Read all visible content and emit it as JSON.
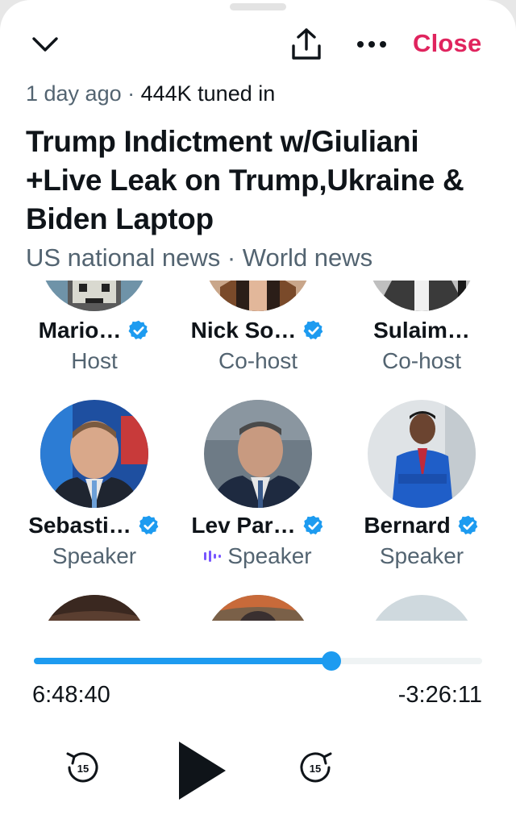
{
  "header": {
    "close_label": "Close",
    "collapse_icon": "chevron-down-icon",
    "share_icon": "share-icon",
    "more_icon": "more-icon"
  },
  "space": {
    "started": "1 day ago",
    "separator": " · ",
    "listeners": "444K tuned in",
    "title": "Trump Indictment w/Giuliani +Live Leak on Trump,Ukraine & Biden Laptop",
    "topics": "US national news · World news"
  },
  "participants": [
    {
      "name": "Mario…",
      "role": "Host",
      "verified": true,
      "speaking": false
    },
    {
      "name": "Nick So…",
      "role": "Co-host",
      "verified": true,
      "speaking": false
    },
    {
      "name": "Sulaim…",
      "role": "Co-host",
      "verified": false,
      "speaking": false
    },
    {
      "name": "Sebasti…",
      "role": "Speaker",
      "verified": true,
      "speaking": false
    },
    {
      "name": "Lev Par…",
      "role": "Speaker",
      "verified": true,
      "speaking": true
    },
    {
      "name": "Bernard",
      "role": "Speaker",
      "verified": true,
      "speaking": false
    }
  ],
  "player": {
    "elapsed": "6:48:40",
    "remaining": "-3:26:11",
    "progress_fraction": 0.663,
    "skip_back_label": "15",
    "skip_forward_label": "15"
  },
  "colors": {
    "accent": "#1d9bf0",
    "close": "#e0245e",
    "speaking": "#7856ff",
    "secondary_text": "#536471"
  }
}
